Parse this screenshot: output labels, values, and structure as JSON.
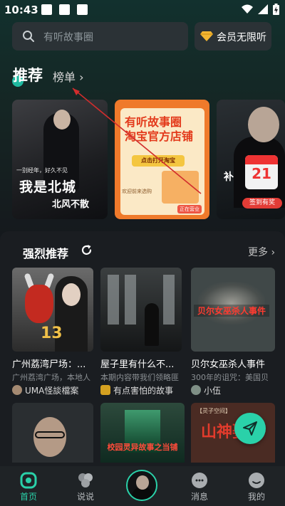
{
  "status_bar": {
    "time": "10:43"
  },
  "search": {
    "placeholder": "有听故事圈"
  },
  "vip": {
    "label": "会员无限听"
  },
  "section_recommend": {
    "title": "推荐",
    "rank_link": "榜单 ›"
  },
  "banners": [
    {
      "subtitle": "一别经年，好久不见",
      "title": "我是北城",
      "title2": "北风不散"
    },
    {
      "title_line1": "有听故事圈",
      "title_line2": "淘宝官方店铺",
      "button": "点击打开淘宝",
      "note": "欢迎前来选购",
      "tag": "正在营业"
    },
    {
      "calendar_day": "21",
      "sign_label": "签到有奖",
      "glyph": "补"
    }
  ],
  "strong_recommend": {
    "title": "强烈推荐",
    "more_label": "更多 ›",
    "cards": [
      {
        "title": "广州荔湾尸场：...",
        "desc": "广州荔湾广场，本地人",
        "author": "UMA怪談檔案",
        "thumb_badge": "13"
      },
      {
        "title": "屋子里有什么不...",
        "desc": "本期内容带我们领略匪",
        "author": "有点害怕的故事"
      },
      {
        "title": "贝尔女巫杀人事件",
        "desc": "300年的诅咒：美国贝",
        "author": "小伍",
        "thumb_label": "贝尔女巫杀人事件"
      }
    ],
    "row2": [
      {
        "label": ""
      },
      {
        "label": "校园灵异故事之当铺"
      },
      {
        "top": "【灵子空间】",
        "big": "山神娶亲"
      }
    ]
  },
  "tabbar": {
    "items": [
      {
        "label": "首页",
        "icon": "home-icon",
        "active": true
      },
      {
        "label": "说说",
        "icon": "chat-bubbles-icon",
        "active": false
      },
      {
        "label": "",
        "icon": "now-playing-disc",
        "active": false
      },
      {
        "label": "消息",
        "icon": "message-icon",
        "active": false
      },
      {
        "label": "我的",
        "icon": "profile-icon",
        "active": false
      }
    ]
  },
  "colors": {
    "accent": "#2ad1a9",
    "background": "#15191d",
    "panel": "#1a1d21"
  }
}
